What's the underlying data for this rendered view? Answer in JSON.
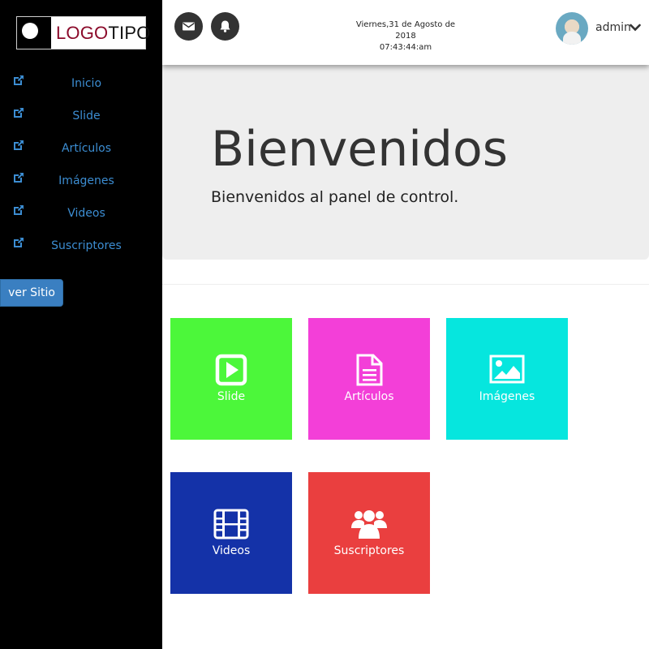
{
  "logo": {
    "part1": "LOGO",
    "part2": "TIPO"
  },
  "sidebar": {
    "items": [
      {
        "label": "Inicio",
        "icon": "external-link-icon"
      },
      {
        "label": "Slide",
        "icon": "external-link-icon"
      },
      {
        "label": "Artículos",
        "icon": "external-link-icon"
      },
      {
        "label": "Imágenes",
        "icon": "external-link-icon"
      },
      {
        "label": "Videos",
        "icon": "external-link-icon"
      },
      {
        "label": "Suscriptores",
        "icon": "external-link-icon"
      }
    ],
    "button": "ver Sitio"
  },
  "header": {
    "date": "Viernes,31 de Agosto de 2018",
    "time": "07:43:44:am",
    "user": "admin",
    "icons": [
      "envelope-icon",
      "bell-icon",
      "chevron-down-icon"
    ]
  },
  "jumbotron": {
    "title": "Bienvenidos",
    "subtitle": "Bienvenidos al panel de control."
  },
  "tiles": [
    {
      "label": "Slide",
      "icon": "play-square-icon",
      "color": "#4cf73a"
    },
    {
      "label": "Artículos",
      "icon": "document-icon",
      "color": "#f33fd8"
    },
    {
      "label": "Imágenes",
      "icon": "image-icon",
      "color": "#06e6de"
    },
    {
      "label": "Videos",
      "icon": "film-icon",
      "color": "#1432a8"
    },
    {
      "label": "Suscriptores",
      "icon": "users-icon",
      "color": "#ea3f3f"
    }
  ],
  "colors": {
    "sidebar_bg": "#000000",
    "link": "#3c8dd2",
    "button": "#3a7fc1",
    "jumbotron_bg": "#eeeeee"
  }
}
